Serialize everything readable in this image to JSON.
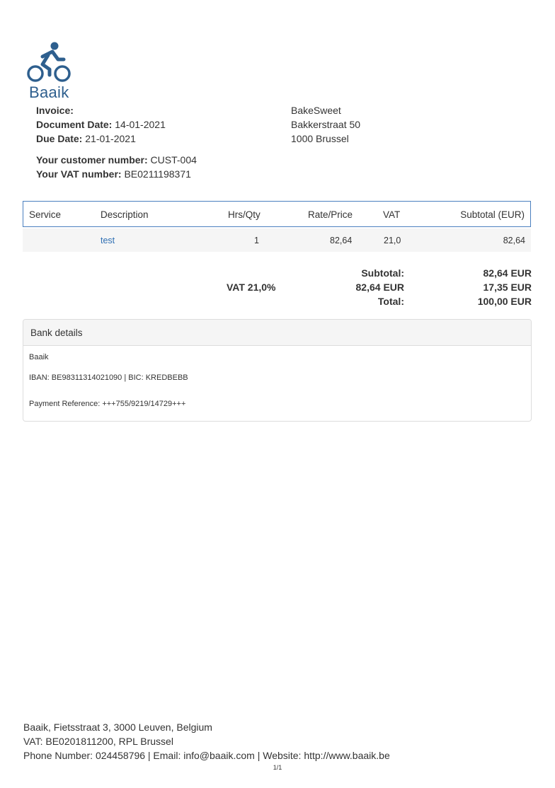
{
  "logo": {
    "name": "Baaik",
    "icon": "cyclist-icon",
    "color": "#2e5f8e"
  },
  "invoice": {
    "invoice_label": "Invoice:",
    "invoice_value": "",
    "doc_date_label": "Document Date:",
    "doc_date_value": "14-01-2021",
    "due_date_label": "Due Date:",
    "due_date_value": "21-01-2021",
    "customer_number_label": "Your customer number:",
    "customer_number_value": "CUST-004",
    "vat_number_label": "Your VAT number:",
    "vat_number_value": "BE0211198371"
  },
  "recipient": {
    "name": "BakeSweet",
    "street": "Bakkerstraat 50",
    "city": "1000 Brussel"
  },
  "table": {
    "headers": [
      "Service",
      "Description",
      "Hrs/Qty",
      "Rate/Price",
      "VAT",
      "Subtotal (EUR)"
    ],
    "rows": [
      {
        "service": "",
        "description": "test",
        "qty": "1",
        "rate": "82,64",
        "vat": "21,0",
        "subtotal": "82,64"
      }
    ],
    "border_color": "#4a7fbf",
    "link_color": "#2f6fb3"
  },
  "totals": {
    "subtotal_label": "Subtotal:",
    "subtotal_value": "82,64 EUR",
    "vat_label": "VAT 21,0%",
    "vat_base": "82,64 EUR",
    "vat_value": "17,35 EUR",
    "total_label": "Total:",
    "total_value": "100,00 EUR"
  },
  "bank": {
    "title": "Bank details",
    "name": "Baaik",
    "iban_bic": "IBAN: BE98311314021090 | BIC: KREDBEBB",
    "payment_reference": "Payment Reference: +++755/9219/14729+++"
  },
  "footer": {
    "address": "Baaik, Fietsstraat 3, 3000 Leuven, Belgium",
    "vat": "VAT: BE0201811200, RPL Brussel",
    "contact": "Phone Number: 024458796 | Email: info@baaik.com | Website: http://www.baaik.be",
    "page": "1/1"
  }
}
